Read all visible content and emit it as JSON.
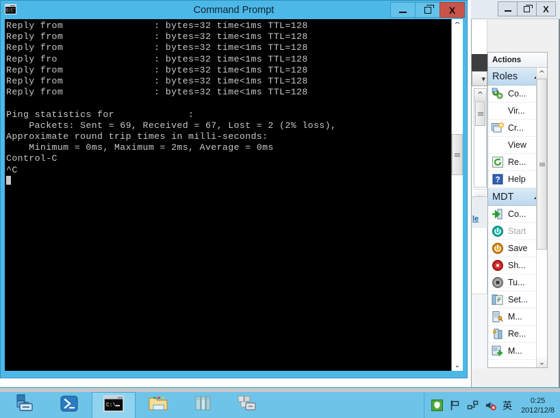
{
  "cmd_window": {
    "title": "Command Prompt",
    "icon": "cmd-icon",
    "icon_text": "C:\\",
    "controls": {
      "minimize": "minimize-icon",
      "maximize": "maximize-icon",
      "close": "X"
    },
    "console_text": "Reply from                : bytes=32 time<1ms TTL=128\nReply from                : bytes=32 time<1ms TTL=128\nReply from                : bytes=32 time<1ms TTL=128\nReply fro                 : bytes=32 time<1ms TTL=128\nReply from                : bytes=32 time<1ms TTL=128\nReply from                : bytes=32 time<1ms TTL=128\nReply from                : bytes=32 time<1ms TTL=128\n\nPing statistics for             :\n    Packets: Sent = 69, Received = 67, Lost = 2 (2% loss),\nApproximate round trip times in milli-seconds:\n    Minimum = 0ms, Maximum = 2ms, Average = 0ms\nControl-C\n^C",
    "scrollbar": {
      "up": "scroll-up-icon",
      "down": "scroll-down-icon"
    }
  },
  "bg_window": {
    "controls": {
      "minimize": "minimize-icon",
      "maximize": "maximize-icon",
      "close": "X"
    },
    "link_text": "le"
  },
  "actions_panel": {
    "header": "Actions",
    "groups": [
      {
        "name": "Roles",
        "collapse_icon": "collapse-triangle-icon",
        "items": [
          {
            "label": "Co...",
            "icon": "green-gears-icon",
            "has_icon": true,
            "submenu": false,
            "disabled": false
          },
          {
            "label": "Vir...",
            "icon": "",
            "has_icon": false,
            "submenu": true,
            "disabled": false
          },
          {
            "label": "Cr...",
            "icon": "windows-create-icon",
            "has_icon": true,
            "submenu": false,
            "disabled": false
          },
          {
            "label": "View",
            "icon": "",
            "has_icon": false,
            "submenu": true,
            "disabled": false
          },
          {
            "label": "Re...",
            "icon": "green-refresh-icon",
            "has_icon": true,
            "submenu": false,
            "disabled": false
          },
          {
            "label": "Help",
            "icon": "blue-question-icon",
            "has_icon": true,
            "submenu": false,
            "disabled": false
          }
        ]
      },
      {
        "name": "MDT",
        "collapse_icon": "collapse-triangle-icon",
        "items": [
          {
            "label": "Co...",
            "icon": "green-arrow-connect-icon",
            "has_icon": true,
            "submenu": false,
            "disabled": false
          },
          {
            "label": "Start",
            "icon": "teal-power-icon",
            "has_icon": true,
            "submenu": false,
            "disabled": true
          },
          {
            "label": "Save",
            "icon": "orange-power-icon",
            "has_icon": true,
            "submenu": false,
            "disabled": false
          },
          {
            "label": "Sh...",
            "icon": "red-shutdown-icon",
            "has_icon": true,
            "submenu": false,
            "disabled": false
          },
          {
            "label": "Tu...",
            "icon": "gray-stop-icon",
            "has_icon": true,
            "submenu": false,
            "disabled": false
          },
          {
            "label": "Set...",
            "icon": "settings-checklist-icon",
            "has_icon": true,
            "submenu": false,
            "disabled": false
          },
          {
            "label": "M...",
            "icon": "server-key-icon",
            "has_icon": true,
            "submenu": false,
            "disabled": false
          },
          {
            "label": "Re...",
            "icon": "server-star-icon",
            "has_icon": true,
            "submenu": true,
            "disabled": false
          },
          {
            "label": "M...",
            "icon": "move-server-icon",
            "has_icon": true,
            "submenu": true,
            "disabled": false
          }
        ]
      }
    ],
    "scrollbar": {
      "up": "scroll-up-icon",
      "down": "scroll-down-icon"
    }
  },
  "taskbar": {
    "buttons": [
      {
        "name": "server-manager",
        "icon": "server-manager-icon",
        "active": false
      },
      {
        "name": "powershell",
        "icon": "powershell-icon",
        "active": false
      },
      {
        "name": "command-prompt",
        "icon": "cmd-icon",
        "active": true
      },
      {
        "name": "file-explorer",
        "icon": "file-explorer-icon",
        "active": false
      },
      {
        "name": "servers",
        "icon": "servers-icon",
        "active": false
      },
      {
        "name": "tools",
        "icon": "tools-icon",
        "active": false
      }
    ],
    "tray": {
      "icons": [
        {
          "name": "security-shield-icon"
        },
        {
          "name": "flag-icon"
        },
        {
          "name": "network-icon"
        },
        {
          "name": "speaker-muted-icon"
        }
      ],
      "ime": "英",
      "time": "0:25",
      "date": "2012/12/8"
    }
  },
  "colors": {
    "title_blue": "#4cb8e8",
    "close_red": "#c9544a",
    "taskbar_blue": "#6ec4e8",
    "console_fg": "#c8c8c8"
  }
}
